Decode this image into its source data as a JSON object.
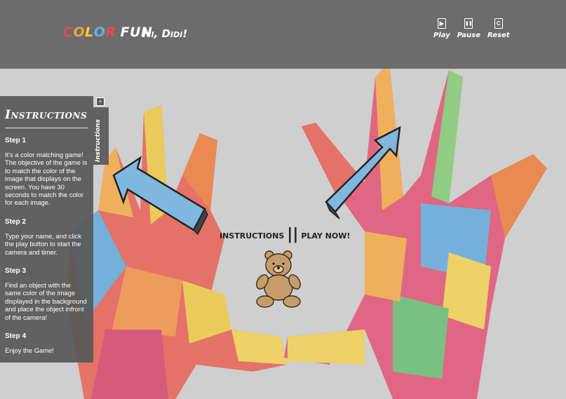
{
  "app": {
    "logo_letters": [
      {
        "ch": "C",
        "color": "#e94a4a"
      },
      {
        "ch": "O",
        "color": "#f2a33a"
      },
      {
        "ch": "L",
        "color": "#f6d03c"
      },
      {
        "ch": "O",
        "color": "#5bb4e8"
      },
      {
        "ch": "R",
        "color": "#e94a4a"
      },
      {
        "ch": " ",
        "color": "#ffffff"
      },
      {
        "ch": "F",
        "color": "#ffffff"
      },
      {
        "ch": "U",
        "color": "#ffffff"
      },
      {
        "ch": "N",
        "color": "#ffffff"
      }
    ],
    "greeting": "Hi, Didi!"
  },
  "controls": {
    "play": {
      "label": "Play",
      "icon": "play-icon",
      "glyph": "▶"
    },
    "pause": {
      "label": "Pause",
      "icon": "pause-icon",
      "glyph": "❚❚"
    },
    "reset": {
      "label": "Reset",
      "icon": "reset-icon",
      "glyph": "C"
    }
  },
  "instructions": {
    "title": "Instructions",
    "tab_label": "Instructions",
    "toggle_glyph": "+",
    "steps": [
      {
        "title": "Step 1",
        "text": "It's a color matching game! The objective of the game is to match the color of the image that displays on the screen. You have 30 seconds to match the color for each image."
      },
      {
        "title": "Step 2",
        "text": "Type your name, and click the play button to start the camera and timer."
      },
      {
        "title": "Step 3",
        "text": "Find an object with the same color of the image displayed in the background and place the object infront of the camera!"
      },
      {
        "title": "Step 4",
        "text": "Enjoy the Game!"
      }
    ]
  },
  "center_nav": {
    "instructions_link": "Instructions",
    "separator": "||",
    "play_now_link": "Play Now!"
  },
  "colors": {
    "header_bg": "#646464",
    "panel_bg": "#585858",
    "arrow_fill": "#7fb8df"
  }
}
